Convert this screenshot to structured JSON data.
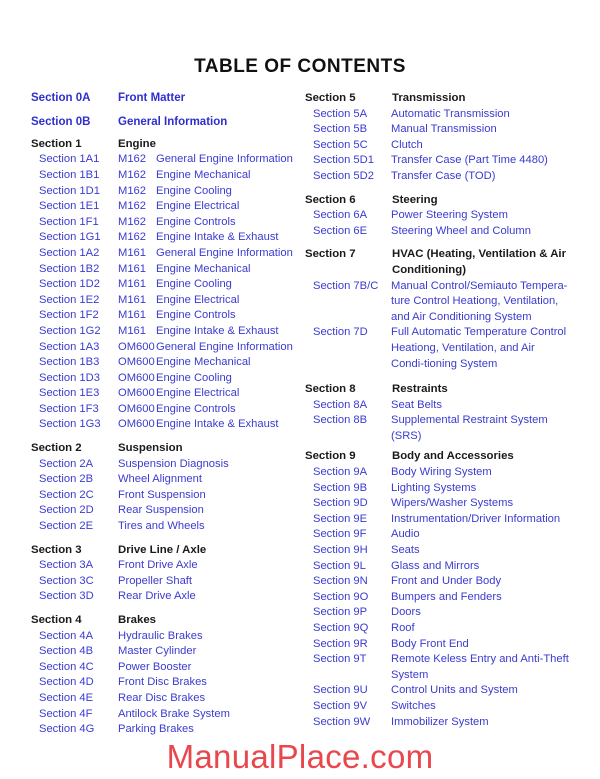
{
  "title": "TABLE OF CONTENTS",
  "colors": {
    "link": "#3b3bd0",
    "heading": "#1a1a1a",
    "watermark": "#e8474c"
  },
  "front": [
    {
      "code": "Section 0A",
      "name": "Front Matter"
    },
    {
      "code": "Section 0B",
      "name": "General Information"
    }
  ],
  "left_groups": [
    {
      "code": "Section 1",
      "name": "Engine",
      "items": [
        {
          "code": "Section 1A1",
          "engine": "M162",
          "name": "General Engine Information"
        },
        {
          "code": "Section 1B1",
          "engine": "M162",
          "name": "Engine Mechanical"
        },
        {
          "code": "Section 1D1",
          "engine": "M162",
          "name": "Engine Cooling"
        },
        {
          "code": "Section 1E1",
          "engine": "M162",
          "name": "Engine Electrical"
        },
        {
          "code": "Section 1F1",
          "engine": "M162",
          "name": "Engine Controls"
        },
        {
          "code": "Section 1G1",
          "engine": "M162",
          "name": "Engine Intake & Exhaust"
        },
        {
          "code": "Section 1A2",
          "engine": "M161",
          "name": "General Engine Information"
        },
        {
          "code": "Section 1B2",
          "engine": "M161",
          "name": "Engine Mechanical"
        },
        {
          "code": "Section 1D2",
          "engine": "M161",
          "name": "Engine Cooling"
        },
        {
          "code": "Section 1E2",
          "engine": "M161",
          "name": "Engine Electrical"
        },
        {
          "code": "Section 1F2",
          "engine": "M161",
          "name": "Engine Controls"
        },
        {
          "code": "Section 1G2",
          "engine": "M161",
          "name": "Engine Intake & Exhaust"
        },
        {
          "code": "Section 1A3",
          "engine": "OM600",
          "name": "General Engine Information"
        },
        {
          "code": "Section 1B3",
          "engine": "OM600",
          "name": "Engine Mechanical"
        },
        {
          "code": "Section 1D3",
          "engine": "OM600",
          "name": "Engine Cooling"
        },
        {
          "code": "Section 1E3",
          "engine": "OM600",
          "name": "Engine Electrical"
        },
        {
          "code": "Section 1F3",
          "engine": "OM600",
          "name": "Engine Controls"
        },
        {
          "code": "Section 1G3",
          "engine": "OM600",
          "name": "Engine Intake & Exhaust"
        }
      ]
    },
    {
      "code": "Section 2",
      "name": "Suspension",
      "items": [
        {
          "code": "Section 2A",
          "name": "Suspension Diagnosis"
        },
        {
          "code": "Section 2B",
          "name": "Wheel Alignment"
        },
        {
          "code": "Section 2C",
          "name": "Front Suspension"
        },
        {
          "code": "Section 2D",
          "name": "Rear Suspension"
        },
        {
          "code": "Section 2E",
          "name": "Tires and Wheels"
        }
      ]
    },
    {
      "code": "Section 3",
      "name": "Drive Line / Axle",
      "items": [
        {
          "code": "Section 3A",
          "name": "Front Drive Axle"
        },
        {
          "code": "Section 3C",
          "name": "Propeller Shaft"
        },
        {
          "code": "Section 3D",
          "name": "Rear Drive Axle"
        }
      ]
    },
    {
      "code": "Section 4",
      "name": "Brakes",
      "items": [
        {
          "code": "Section 4A",
          "name": "Hydraulic Brakes"
        },
        {
          "code": "Section 4B",
          "name": "Master Cylinder"
        },
        {
          "code": "Section 4C",
          "name": "Power Booster"
        },
        {
          "code": "Section 4D",
          "name": "Front Disc Brakes"
        },
        {
          "code": "Section 4E",
          "name": "Rear Disc Brakes"
        },
        {
          "code": "Section 4F",
          "name": "Antilock Brake System"
        },
        {
          "code": "Section 4G",
          "name": "Parking Brakes"
        }
      ]
    }
  ],
  "right_groups": [
    {
      "code": "Section 5",
      "name": "Transmission",
      "items": [
        {
          "code": "Section 5A",
          "name": "Automatic Transmission"
        },
        {
          "code": "Section 5B",
          "name": "Manual Transmission"
        },
        {
          "code": "Section 5C",
          "name": "Clutch"
        },
        {
          "code": "Section 5D1",
          "name": "Transfer Case (Part Time 4480)"
        },
        {
          "code": "Section 5D2",
          "name": "Transfer Case (TOD)"
        }
      ]
    },
    {
      "code": "Section 6",
      "name": "Steering",
      "items": [
        {
          "code": "Section 6A",
          "name": "Power Steering System"
        },
        {
          "code": "Section 6E",
          "name": "Steering Wheel and Column"
        }
      ]
    },
    {
      "code": "Section 7",
      "name": "HVAC (Heating, Ventilation & Air Conditioning)",
      "items": [
        {
          "code": "Section 7B/C",
          "name": "Manual Control/Semiauto Tempera-ture Control Heationg, Ventilation, and Air Conditioning System"
        },
        {
          "code": "Section 7D",
          "name": "Full Automatic Temperature Control Heationg, Ventilation, and Air Condi-tioning System"
        }
      ]
    },
    {
      "code": "Section 8",
      "name": "Restraints",
      "items": [
        {
          "code": "Section 8A",
          "name": "Seat Belts"
        },
        {
          "code": "Section 8B",
          "name": "Supplemental Restraint System (SRS)"
        }
      ]
    },
    {
      "code": "Section 9",
      "name": "Body and Accessories",
      "items": [
        {
          "code": "Section 9A",
          "name": "Body Wiring System"
        },
        {
          "code": "Section 9B",
          "name": "Lighting Systems"
        },
        {
          "code": "Section 9D",
          "name": "Wipers/Washer Systems"
        },
        {
          "code": "Section 9E",
          "name": "Instrumentation/Driver Information"
        },
        {
          "code": "Section 9F",
          "name": "Audio"
        },
        {
          "code": "Section 9H",
          "name": "Seats"
        },
        {
          "code": "Section 9L",
          "name": "Glass and Mirrors"
        },
        {
          "code": "Section 9N",
          "name": "Front and Under Body"
        },
        {
          "code": "Section 9O",
          "name": "Bumpers and Fenders"
        },
        {
          "code": "Section 9P",
          "name": "Doors"
        },
        {
          "code": "Section 9Q",
          "name": "Roof"
        },
        {
          "code": "Section 9R",
          "name": "Body Front End"
        },
        {
          "code": "Section 9T",
          "name": "Remote Keless Entry and Anti-Theft System"
        },
        {
          "code": "Section 9U",
          "name": "Control Units and System"
        },
        {
          "code": "Section 9V",
          "name": "Switches"
        },
        {
          "code": "Section 9W",
          "name": "Immobilizer System"
        }
      ]
    }
  ],
  "watermark": "ManualPlace.com"
}
